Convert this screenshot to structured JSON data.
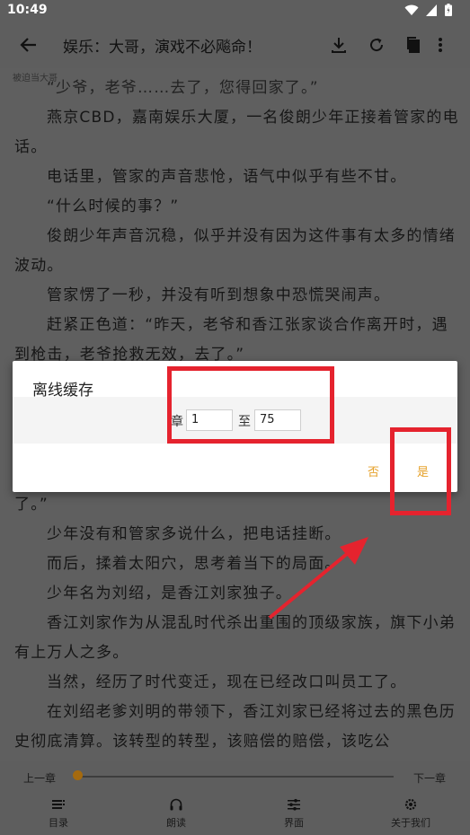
{
  "status": {
    "time": "10:49"
  },
  "toolbar": {
    "title": "娱乐：大哥，演戏不必飚命！"
  },
  "chapter_label": "被迫当大哥",
  "reader": {
    "paragraphs_top": [
      "“少爷，老爷……去了，您得回家了。”",
      "燕京CBD，嘉南娱乐大厦，一名俊朗少年正接着管家的电话。",
      "电话里，管家的声音悲怆，语气中似乎有些不甘。",
      "“什么时候的事？”",
      "俊朗少年声音沉稳，似乎并没有因为这件事有太多的情绪波动。",
      "管家愣了一秒，并没有听到想象中恐慌哭闹声。",
      "赶紧正色道：“昨天，老爷和香江张家谈合作离开时，遇到枪击，老爷抢救无效，去了。”"
    ],
    "fragment": "了。”",
    "paragraphs_bottom": [
      "少年没有和管家多说什么，把电话挂断。",
      "而后，揉着太阳穴，思考着当下的局面。",
      "少年名为刘绍，是香江刘家独子。",
      "香江刘家作为从混乱时代杀出重围的顶级家族，旗下小弟有上万人之多。",
      "当然，经历了时代变迁，现在已经改口叫员工了。",
      "在刘绍老爹刘明的带领下，香江刘家已经将过去的黑色历史彻底清算。该转型的转型，该赔偿的赔偿，该吃公"
    ]
  },
  "dialog": {
    "title": "离线缓存",
    "zhang": "章",
    "from_value": "1",
    "zhi": "至",
    "to_value": "75",
    "no": "否",
    "yes": "是"
  },
  "bottom": {
    "prev": "上一章",
    "next": "下一章",
    "progress": 0.0,
    "nav": [
      "目录",
      "朗读",
      "界面",
      "关于我们"
    ]
  },
  "colors": {
    "accent": "#e6a12a",
    "highlight": "#e5232e"
  }
}
